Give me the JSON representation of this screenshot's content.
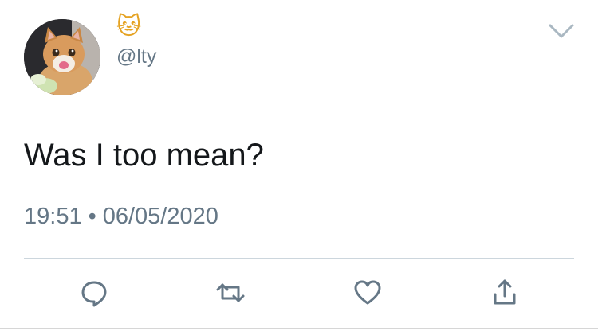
{
  "author": {
    "display_name": "🐱",
    "handle": "@lty"
  },
  "tweet": {
    "text": "Was I too mean?",
    "time": "19:51",
    "separator": "•",
    "date": "06/05/2020"
  },
  "icons": {
    "avatar": "crying-cat-photo",
    "caret": "chevron-down-icon",
    "reply": "reply-bubble-icon",
    "retweet": "retweet-icon",
    "like": "heart-icon",
    "share": "share-icon"
  },
  "colors": {
    "text": "#14171a",
    "secondary": "#657786",
    "divider": "#ccd6dd",
    "icon": "#657786"
  }
}
